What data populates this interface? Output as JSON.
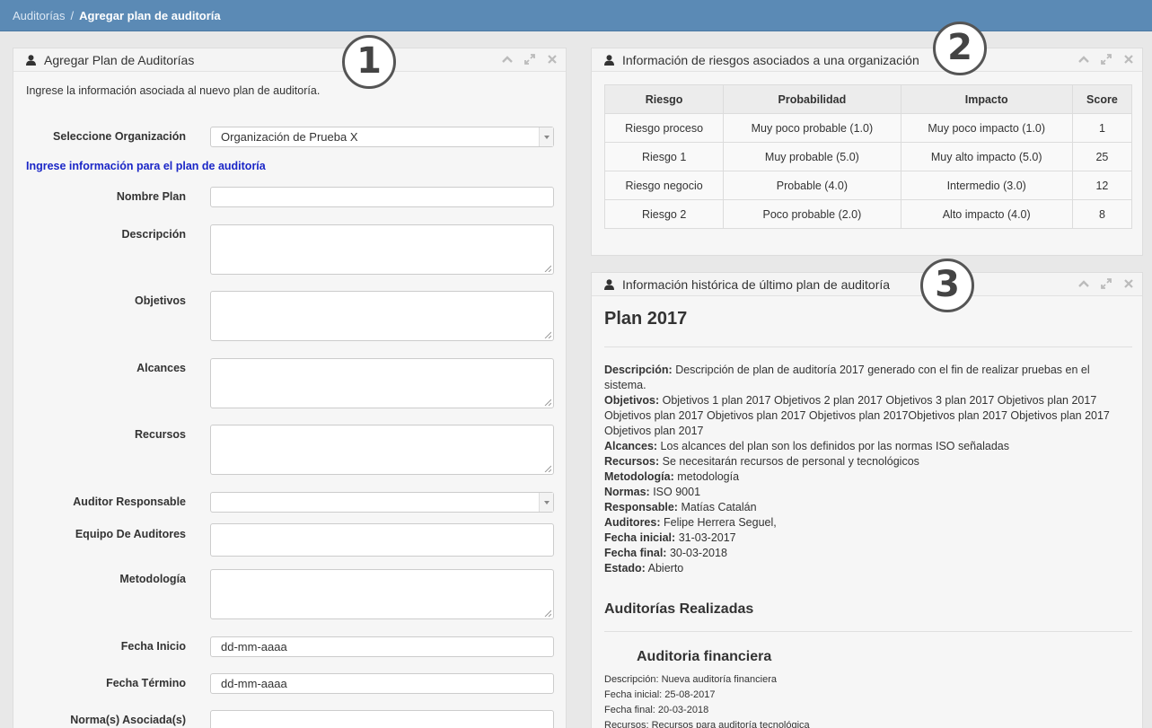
{
  "breadcrumb": {
    "parent": "Auditorías",
    "separator": "/",
    "current": "Agregar plan de auditoría"
  },
  "callouts": [
    "1",
    "2",
    "3"
  ],
  "form_panel": {
    "title": "Agregar Plan de Auditorías",
    "intro": "Ingrese la información asociada al nuevo plan de auditoría.",
    "org_label": "Seleccione Organización",
    "org_value": "Organización de Prueba X",
    "section_heading": "Ingrese información para el plan de auditoría",
    "fields": {
      "nombre": "Nombre Plan",
      "descripcion": "Descripción",
      "objetivos": "Objetivos",
      "alcances": "Alcances",
      "recursos": "Recursos",
      "auditor": "Auditor Responsable",
      "equipo": "Equipo De Auditores",
      "metodologia": "Metodología",
      "fecha_inicio": "Fecha Inicio",
      "fecha_termino": "Fecha Término",
      "normas": "Norma(s) Asociada(s)"
    },
    "date_placeholder": "dd-mm-aaaa"
  },
  "risk_panel": {
    "title": "Información de riesgos asociados a una organización",
    "headers": [
      "Riesgo",
      "Probabilidad",
      "Impacto",
      "Score"
    ],
    "rows": [
      [
        "Riesgo proceso",
        "Muy poco probable (1.0)",
        "Muy poco impacto (1.0)",
        "1"
      ],
      [
        "Riesgo 1",
        "Muy probable (5.0)",
        "Muy alto impacto (5.0)",
        "25"
      ],
      [
        "Riesgo negocio",
        "Probable (4.0)",
        "Intermedio (3.0)",
        "12"
      ],
      [
        "Riesgo 2",
        "Poco probable (2.0)",
        "Alto impacto (4.0)",
        "8"
      ]
    ]
  },
  "history_panel": {
    "title": "Información histórica de último plan de auditoría",
    "plan_title": "Plan 2017",
    "details": [
      {
        "label": "Descripción:",
        "value": "Descripción de plan de auditoría 2017 generado con el fin de realizar pruebas en el sistema."
      },
      {
        "label": "Objetivos:",
        "value": "Objetivos 1 plan 2017 Objetivos 2 plan 2017 Objetivos 3 plan 2017 Objetivos plan 2017 Objetivos plan 2017 Objetivos plan 2017 Objetivos plan 2017Objetivos plan 2017 Objetivos plan 2017 Objetivos plan 2017"
      },
      {
        "label": "Alcances:",
        "value": "Los alcances del plan son los definidos por las normas ISO señaladas"
      },
      {
        "label": "Recursos:",
        "value": "Se necesitarán recursos de personal y tecnológicos"
      },
      {
        "label": "Metodología:",
        "value": "metodología"
      },
      {
        "label": "Normas:",
        "value": "ISO 9001"
      },
      {
        "label": "Responsable:",
        "value": "Matías Catalán"
      },
      {
        "label": "Auditores:",
        "value": "Felipe Herrera Seguel,"
      },
      {
        "label": "Fecha inicial:",
        "value": "31-03-2017"
      },
      {
        "label": "Fecha final:",
        "value": "30-03-2018"
      },
      {
        "label": "Estado:",
        "value": "Abierto"
      }
    ],
    "audits_heading": "Auditorías Realizadas",
    "audit_title": "Auditoria financiera",
    "audit_lines": [
      "Descripción: Nueva auditoría financiera",
      "Fecha inicial: 25-08-2017",
      "Fecha final: 20-03-2018",
      "Recursos: Recursos para auditoría tecnológica"
    ]
  }
}
